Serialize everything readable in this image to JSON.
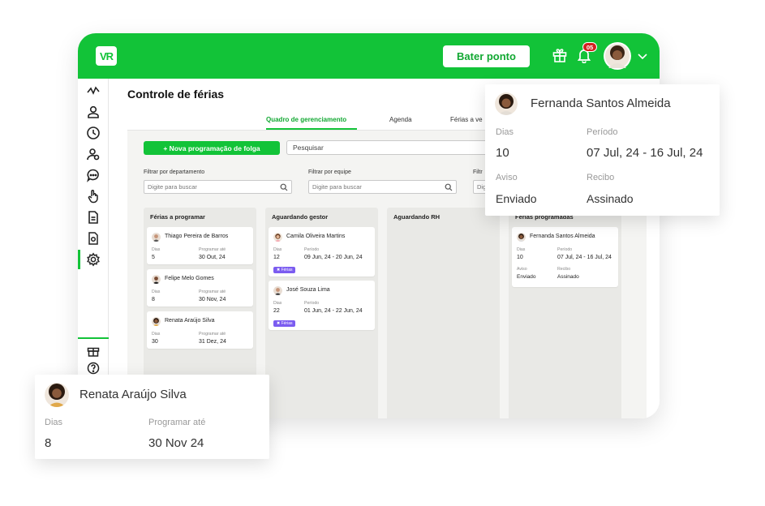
{
  "app": {
    "logo_text": "VR",
    "accent": "#12c338"
  },
  "topbar": {
    "ponto_label": "Bater ponto",
    "notifications_count": "05"
  },
  "page": {
    "title": "Controle de férias"
  },
  "tabs": [
    {
      "label": "Quadro de gerenciamento",
      "active": true
    },
    {
      "label": "Agenda",
      "active": false
    },
    {
      "label": "Férias a ve",
      "active": false
    }
  ],
  "toolbar": {
    "new_label": "+ Nova programação de folga",
    "search_value": "Pesquisar"
  },
  "filters": [
    {
      "label": "Filtrar por departamento",
      "placeholder": "Digite para buscar"
    },
    {
      "label": "Filtrar por equipe",
      "placeholder": "Digite para buscar"
    },
    {
      "label": "Filtr",
      "placeholder": "Dig"
    }
  ],
  "columns": {
    "programar": {
      "title": "Férias a programar",
      "cards": [
        {
          "name": "Thiago Pereira de Barros",
          "l1": "Dias",
          "v1": "5",
          "l2": "Programar até",
          "v2": "30 Out, 24"
        },
        {
          "name": "Felipe Melo Gomes",
          "l1": "Dias",
          "v1": "8",
          "l2": "Programar até",
          "v2": "30 Nov, 24"
        },
        {
          "name": "Renata Araújo Silva",
          "l1": "Dias",
          "v1": "30",
          "l2": "Programar até",
          "v2": "31 Dez, 24"
        }
      ]
    },
    "gestor": {
      "title": "Aguardando gestor",
      "cards": [
        {
          "name": "Camila Oliveira Martins",
          "l1": "Dias",
          "v1": "12",
          "l2": "Período",
          "v2": "09 Jun, 24 - 20 Jun, 24",
          "tag": "✖ Férias"
        },
        {
          "name": "José Souza Lima",
          "l1": "Dias",
          "v1": "22",
          "l2": "Período",
          "v2": "01 Jun, 24 - 22 Jun, 24",
          "tag": "✖ Férias"
        }
      ]
    },
    "rh": {
      "title": "Aguardando RH"
    },
    "programadas": {
      "title": "Férias programadas",
      "cards": [
        {
          "name": "Fernanda Santos Almeida",
          "l1": "Dias",
          "v1": "10",
          "l2": "Período",
          "v2": "07 Jul, 24 - 16 Jul, 24",
          "l3": "Aviso",
          "v3": "Enviado",
          "l4": "Recibo",
          "v4": "Assinado"
        }
      ]
    }
  },
  "popup_fernanda": {
    "name": "Fernanda Santos Almeida",
    "dias_label": "Dias",
    "dias": "10",
    "periodo_label": "Período",
    "periodo": "07 Jul, 24 - 16 Jul, 24",
    "aviso_label": "Aviso",
    "aviso": "Enviado",
    "recibo_label": "Recibo",
    "recibo": "Assinado"
  },
  "popup_renata": {
    "name": "Renata Araújo Silva",
    "dias_label": "Dias",
    "dias": "8",
    "prog_label": "Programar até",
    "prog": "30 Nov 24"
  }
}
